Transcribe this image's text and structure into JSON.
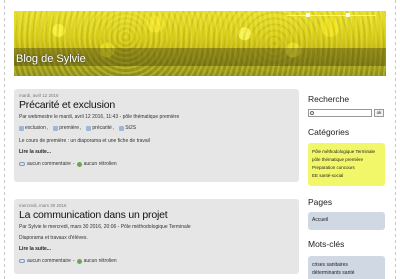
{
  "header": {
    "blog_title": "Blog de Sylvie"
  },
  "posts": [
    {
      "date": "mardi, avril 12 2016",
      "title": "Précarité et exclusion",
      "meta": "Par webmestre le mardi, avril 12 2016, 11:43 - pôle thématique première",
      "tags": [
        "exclusion",
        "première",
        "précarité",
        "St2S"
      ],
      "excerpt": "Le cours de première : un diaporama et une fiche de travail",
      "more": "Lire la suite...",
      "comments": "aucun commentaire",
      "trackbacks": "aucun rétrolien"
    },
    {
      "date": "mercredi, mars 30 2016",
      "title": "La communication dans un projet",
      "meta": "Par Sylvie le mercredi, mars 30 2016, 20:06 - Pôle méthodologique Terminale",
      "excerpt": "Diaporama et travaux d'élèves.",
      "more": "Lire la suite...",
      "comments": "aucun commentaire",
      "trackbacks": "aucun rétrolien"
    }
  ],
  "sidebar": {
    "search_heading": "Recherche",
    "search_placeholder": "",
    "ok_label": "ok",
    "categories_heading": "Catégories",
    "categories": [
      "Pôle méthodologique Terminale",
      "pôle thématique première",
      "Preparation concours",
      "EE santé-social"
    ],
    "pages_heading": "Pages",
    "pages": [
      "Accueil"
    ],
    "tags_heading": "Mots-clés",
    "tags": [
      "crises sanitaires",
      "déterminants santé"
    ]
  },
  "colors": {
    "post_bg": "#e6e6e6",
    "categories_bg": "#f2f76a",
    "pages_bg": "#cfd8e3"
  }
}
